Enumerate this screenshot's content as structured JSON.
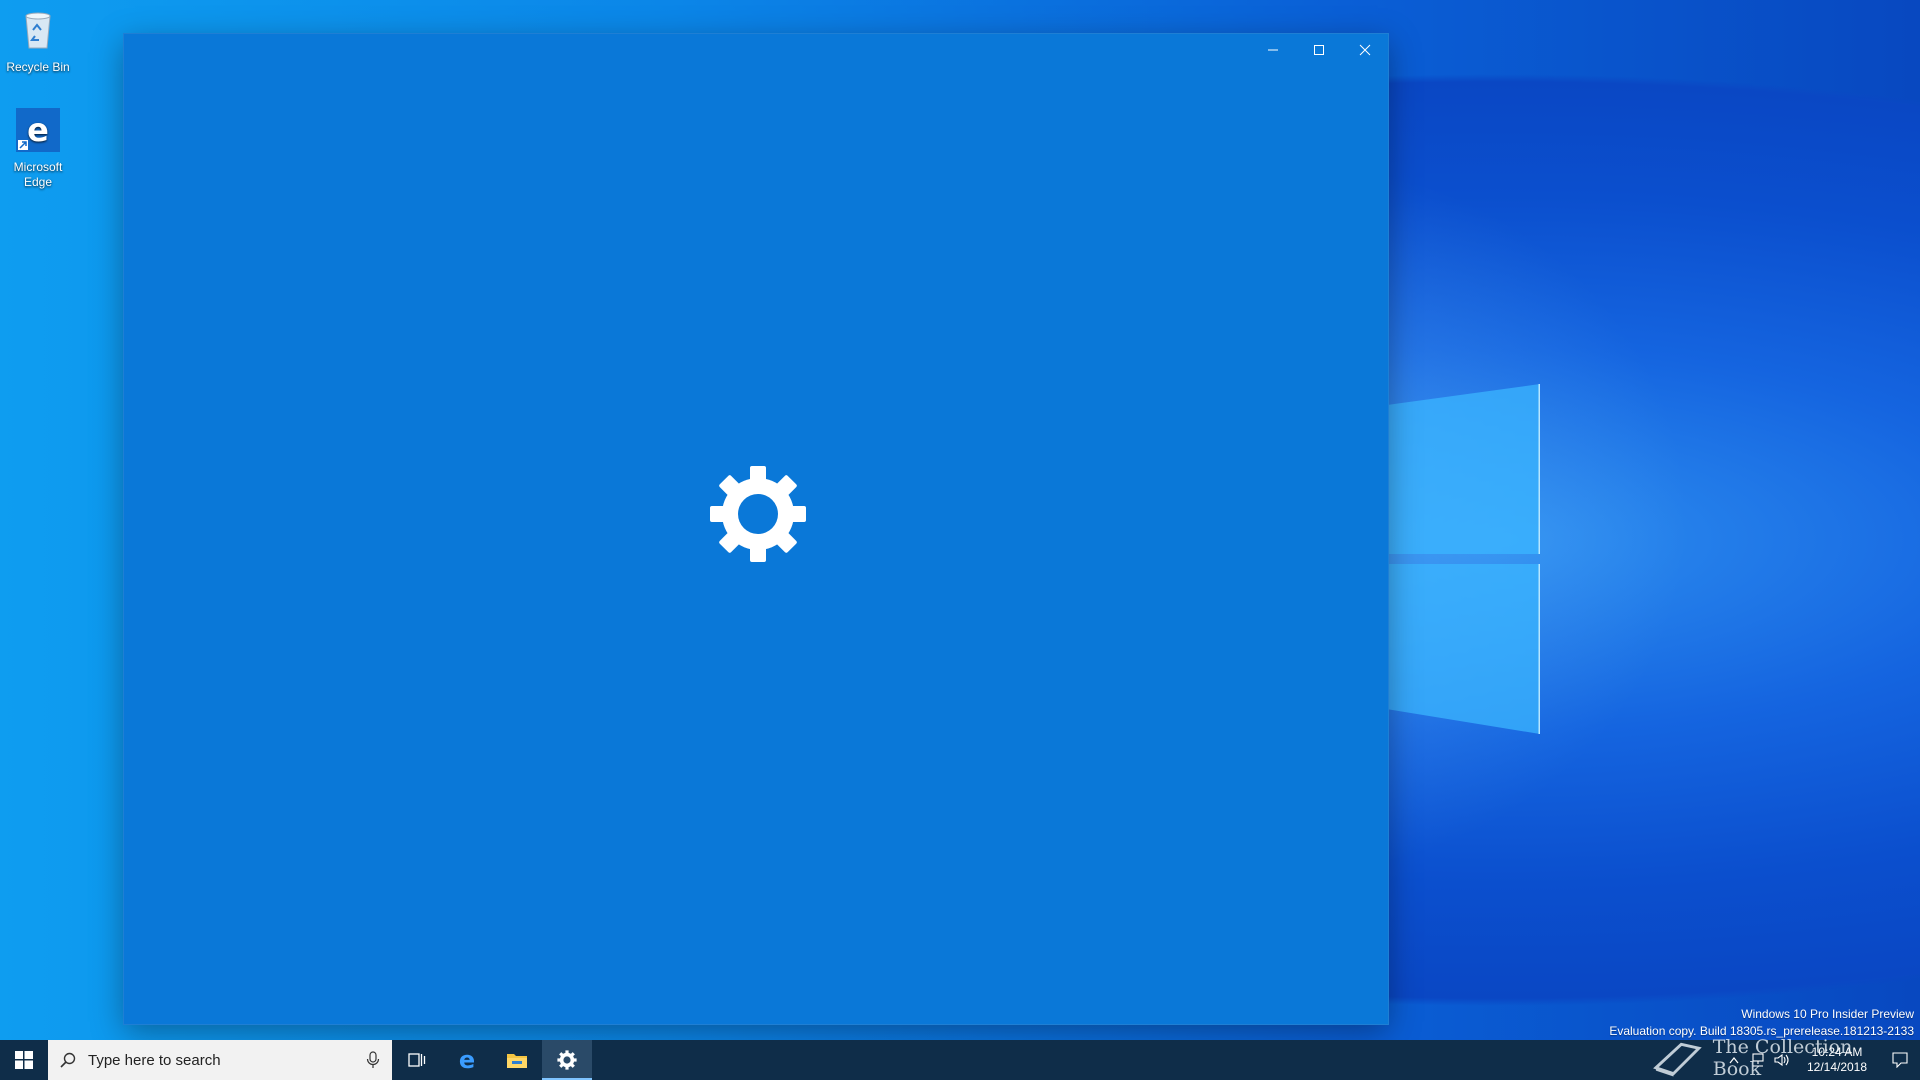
{
  "desktop": {
    "icons": [
      {
        "label": "Recycle Bin"
      },
      {
        "label": "Microsoft Edge"
      }
    ]
  },
  "window": {
    "splash_icon": "gear-icon",
    "controls": [
      "minimize-icon",
      "maximize-icon",
      "close-icon"
    ]
  },
  "watermark": {
    "line1": "Windows 10 Pro Insider Preview",
    "line2": "Evaluation copy. Build 18305.rs_prerelease.181213-2133"
  },
  "taskbar": {
    "search_placeholder": "Type here to search",
    "pinned": [
      "task-view-icon",
      "edge-icon",
      "file-explorer-icon",
      "settings-icon"
    ],
    "active_app": "settings-icon",
    "clock_time": "10:24 AM",
    "clock_date": "12/14/2018",
    "overlay_brand": "The Collection Book"
  },
  "colors": {
    "window_bg": "#0a78d8",
    "taskbar_bg": "#0f2d49",
    "accent": "#7fc4ff"
  }
}
